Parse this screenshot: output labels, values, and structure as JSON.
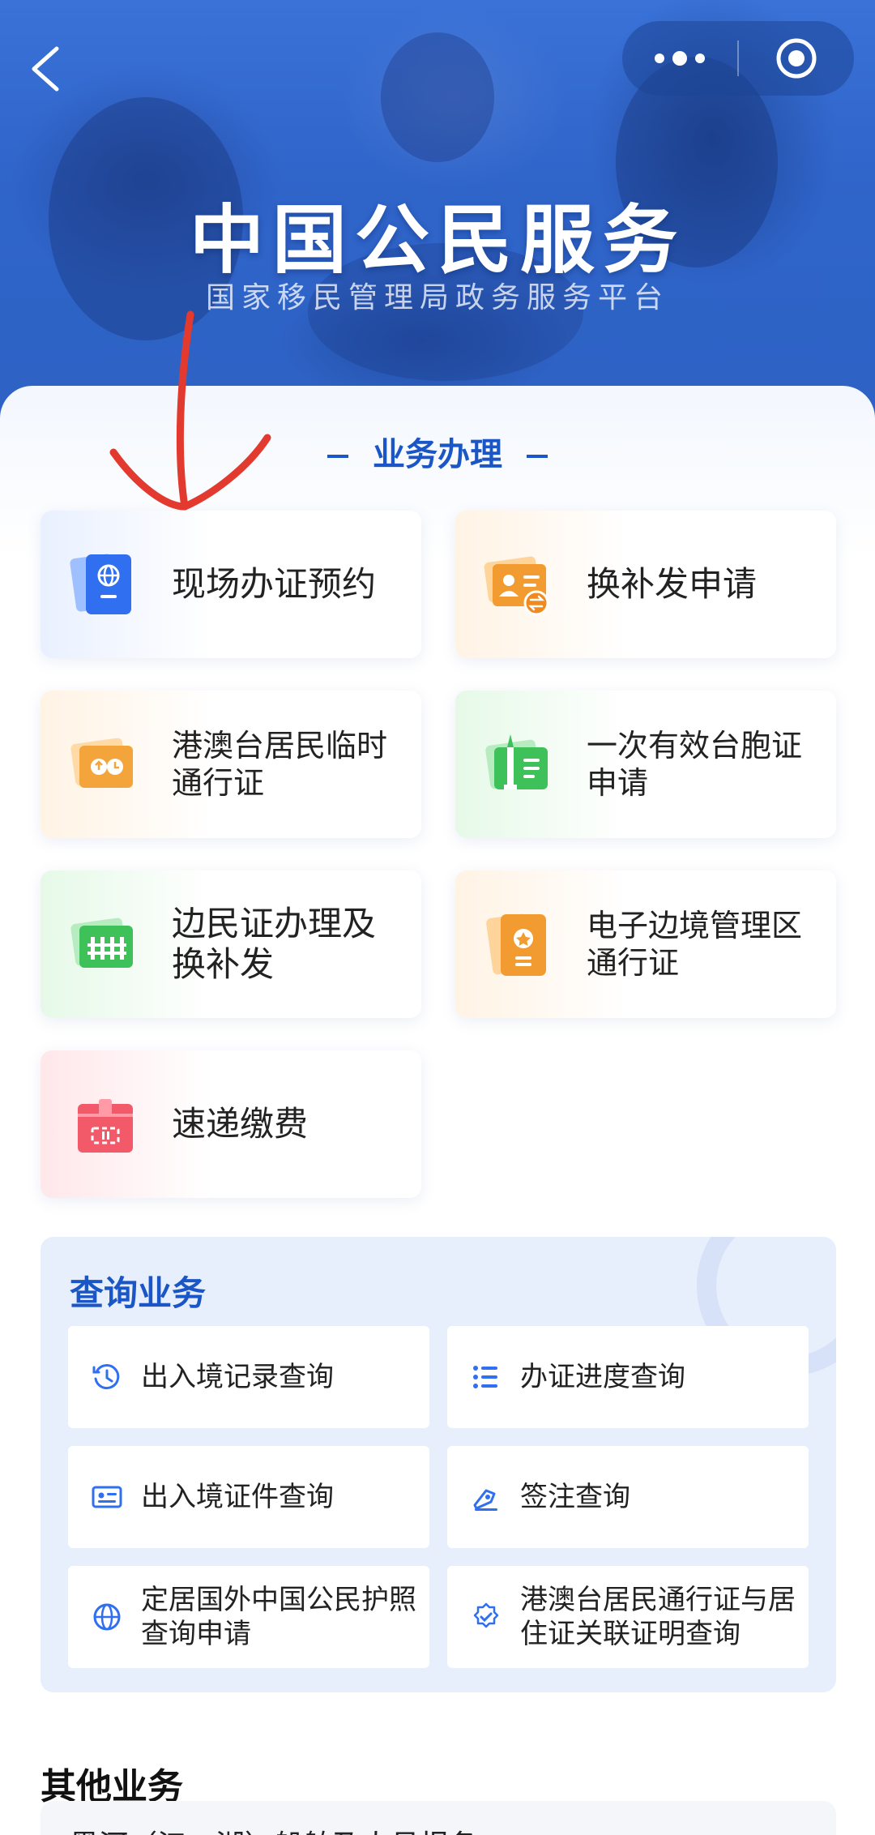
{
  "hero": {
    "title": "中国公民服务",
    "subtitle": "国家移民管理局政务服务平台"
  },
  "nav": {
    "back_icon": "chevron-left-icon",
    "more_icon": "more-dots-icon",
    "close_icon": "target-close-icon"
  },
  "section": {
    "title": "业务办理"
  },
  "services": [
    {
      "label": "现场办证预约",
      "icon": "passport-globe-icon",
      "color": "#2f6ff0"
    },
    {
      "label": "换补发申请",
      "icon": "id-card-exchange-icon",
      "color": "#f29b30"
    },
    {
      "label": "港澳台居民临时通行证",
      "icon": "travel-permit-icon",
      "color": "#f3a53c"
    },
    {
      "label": "一次有效台胞证申请",
      "icon": "tower-card-icon",
      "color": "#3fc15a"
    },
    {
      "label": "边民证办理及换补发",
      "icon": "border-card-icon",
      "color": "#3fc15a"
    },
    {
      "label": "电子边境管理区通行证",
      "icon": "star-document-icon",
      "color": "#f29b30"
    },
    {
      "label": "速递缴费",
      "icon": "parcel-box-icon",
      "color": "#f25a6a"
    }
  ],
  "query": {
    "title": "查询业务",
    "items": [
      {
        "label": "出入境记录查询",
        "icon": "history-clock-icon"
      },
      {
        "label": "办证进度查询",
        "icon": "checklist-icon"
      },
      {
        "label": "出入境证件查询",
        "icon": "id-card-icon"
      },
      {
        "label": "签注查询",
        "icon": "stamp-tag-icon"
      },
      {
        "label": "定居国外中国公民护照查询申请",
        "icon": "globe-icon"
      },
      {
        "label": "港澳台居民通行证与居住证关联证明查询",
        "icon": "verified-badge-icon"
      }
    ]
  },
  "other": {
    "title": "其他业务",
    "first_item": "黑河（江、湖）船舶及人员报备"
  },
  "colors": {
    "accent": "#1b56c7",
    "annotation_arrow": "#e23a2e"
  }
}
